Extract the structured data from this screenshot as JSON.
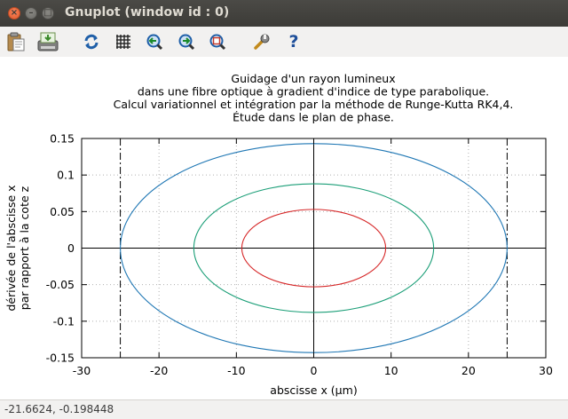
{
  "window": {
    "title": "Gnuplot (window id : 0)",
    "close_glyph": "×",
    "min_glyph": "–",
    "max_glyph": "□"
  },
  "toolbar": {
    "items": [
      {
        "name": "copy-to-clipboard-icon"
      },
      {
        "name": "print-icon"
      },
      {
        "name": "replot-icon"
      },
      {
        "name": "grid-icon"
      },
      {
        "name": "previous-zoom-icon"
      },
      {
        "name": "next-zoom-icon"
      },
      {
        "name": "autoscale-icon"
      },
      {
        "name": "settings-icon"
      },
      {
        "name": "help-icon"
      }
    ],
    "help_glyph": "?"
  },
  "status": {
    "coordinates": "-21.6624, -0.198448"
  },
  "chart_data": {
    "type": "line",
    "title": [
      "Guidage d'un rayon lumineux",
      "dans une fibre optique à gradient d'indice de type parabolique.",
      "Calcul variationnel et intégration par la méthode de Runge-Kutta RK4,4.",
      "Étude dans le plan de phase."
    ],
    "xlabel": "abscisse x (µm)",
    "ylabel": [
      "dérivée de l'abscisse x",
      "par rapport à la cote z"
    ],
    "xlim": [
      -30,
      30
    ],
    "ylim": [
      -0.15,
      0.15
    ],
    "xticks": [
      -30,
      -20,
      -10,
      0,
      10,
      20,
      30
    ],
    "xtick_labels": [
      "-30",
      "-20",
      "-10",
      "0",
      "10",
      "20",
      "30"
    ],
    "yticks": [
      -0.15,
      -0.1,
      -0.05,
      0,
      0.05,
      0.1,
      0.15
    ],
    "ytick_labels": [
      "-0.15",
      "-0.1",
      "-0.05",
      "0",
      "0.05",
      "0.1",
      "0.15"
    ],
    "grid": true,
    "series": [
      {
        "shape": "ellipse",
        "cx": 0,
        "cy": 0,
        "rx": 25,
        "ry": 0.143,
        "color": "#1f77b4"
      },
      {
        "shape": "ellipse",
        "cx": 0,
        "cy": 0,
        "rx": 15.5,
        "ry": 0.088,
        "color": "#1a9e77"
      },
      {
        "shape": "ellipse",
        "cx": 0,
        "cy": 0,
        "rx": 9.3,
        "ry": 0.053,
        "color": "#d62728"
      }
    ],
    "vertical_lines": [
      {
        "x": -25,
        "style": "dash-dot",
        "color": "#000000"
      },
      {
        "x": 25,
        "style": "dash-dot",
        "color": "#000000"
      }
    ],
    "axes_zero_lines": true
  }
}
